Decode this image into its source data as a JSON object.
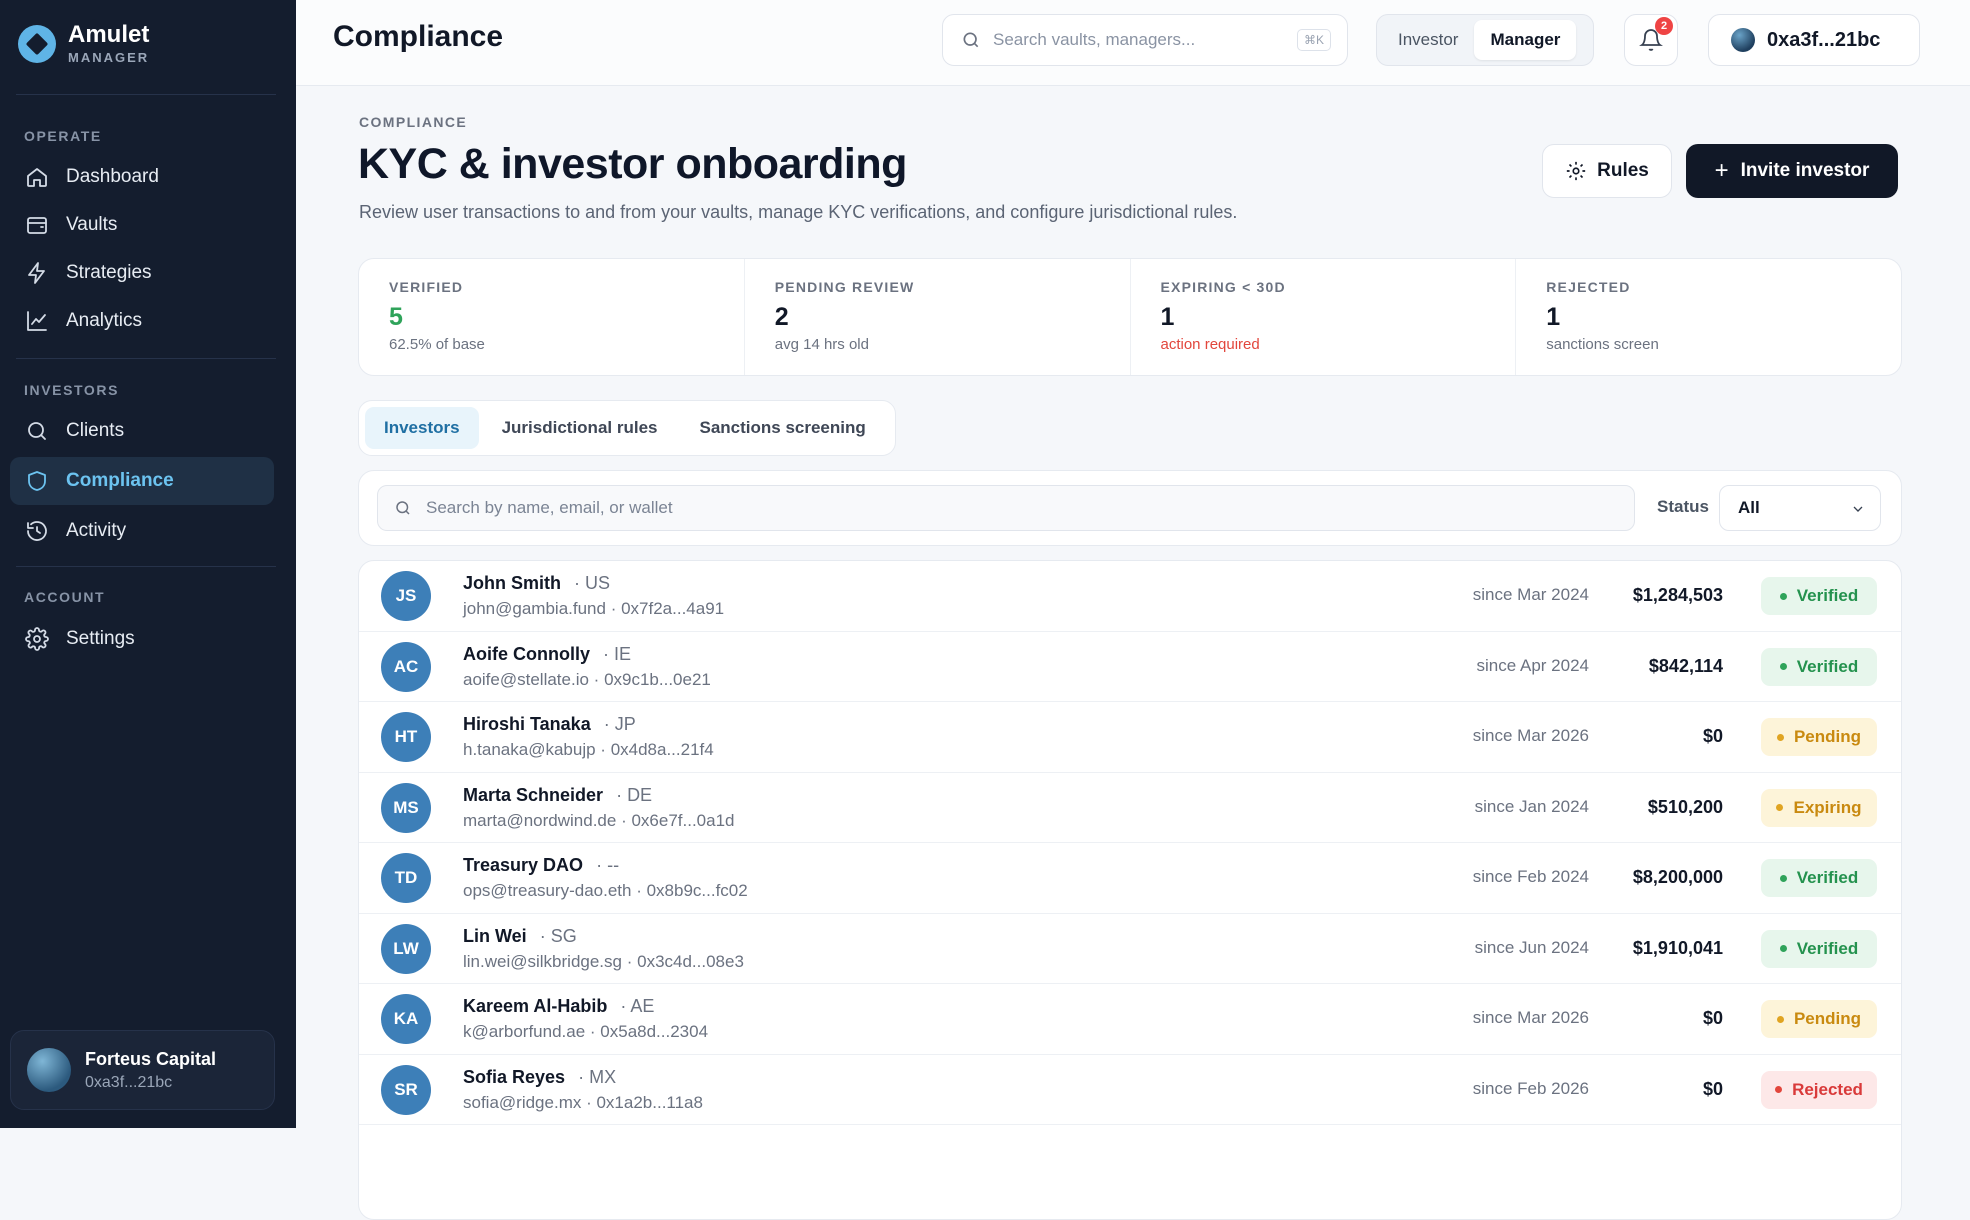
{
  "app": {
    "name": "Amulet",
    "subtitle": "MANAGER"
  },
  "sidebar": {
    "sections": [
      {
        "label": "OPERATE"
      },
      {
        "label": "INVESTORS"
      },
      {
        "label": "ACCOUNT"
      }
    ],
    "items": [
      {
        "label": "Dashboard",
        "icon": "home-icon"
      },
      {
        "label": "Vaults",
        "icon": "wallet-icon"
      },
      {
        "label": "Strategies",
        "icon": "lightning-icon"
      },
      {
        "label": "Analytics",
        "icon": "chart-icon"
      },
      {
        "label": "Clients",
        "icon": "search-icon"
      },
      {
        "label": "Compliance",
        "icon": "shield-icon",
        "active": true
      },
      {
        "label": "Activity",
        "icon": "history-icon"
      },
      {
        "label": "Settings",
        "icon": "gear-icon"
      }
    ],
    "org": {
      "name": "Forteus Capital",
      "wallet": "0xa3f...21bc"
    }
  },
  "topbar": {
    "title": "Compliance",
    "search_placeholder": "Search vaults, managers...",
    "shortcut": "⌘K",
    "roles": [
      "Investor",
      "Manager"
    ],
    "active_role": "Manager",
    "notification_count": "2",
    "wallet": "0xa3f...21bc"
  },
  "page": {
    "eyebrow": "COMPLIANCE",
    "title": "KYC & investor onboarding",
    "subtitle": "Review user transactions to and from your vaults, manage KYC verifications, and configure jurisdictional rules.",
    "rules_label": "Rules",
    "invite_label": "Invite investor",
    "invite_symbol": "+"
  },
  "stats": [
    {
      "label": "VERIFIED",
      "value": "5",
      "note": "62.5% of base"
    },
    {
      "label": "PENDING REVIEW",
      "value": "2",
      "note": "avg 14 hrs old"
    },
    {
      "label": "EXPIRING < 30D",
      "value": "1",
      "note": "action required"
    },
    {
      "label": "REJECTED",
      "value": "1",
      "note": "sanctions screen"
    }
  ],
  "tabs": [
    "Investors",
    "Jurisdictional rules",
    "Sanctions screening"
  ],
  "filters": {
    "search_placeholder": "Search by name, email, or wallet",
    "status_label": "Status",
    "status_value": "All"
  },
  "investors": [
    {
      "initials": "JS",
      "name": "John Smith",
      "country": "US",
      "email": "john@gambia.fund",
      "wallet": "0x7f2a...4a91",
      "since": "since Mar 2024",
      "amount": "$1,284,503",
      "status": "Verified"
    },
    {
      "initials": "AC",
      "name": "Aoife Connolly",
      "country": "IE",
      "email": "aoife@stellate.io",
      "wallet": "0x9c1b...0e21",
      "since": "since Apr 2024",
      "amount": "$842,114",
      "status": "Verified"
    },
    {
      "initials": "HT",
      "name": "Hiroshi Tanaka",
      "country": "JP",
      "email": "h.tanaka@kabujp",
      "wallet": "0x4d8a...21f4",
      "since": "since Mar 2026",
      "amount": "$0",
      "status": "Pending"
    },
    {
      "initials": "MS",
      "name": "Marta Schneider",
      "country": "DE",
      "email": "marta@nordwind.de",
      "wallet": "0x6e7f...0a1d",
      "since": "since Jan 2024",
      "amount": "$510,200",
      "status": "Expiring"
    },
    {
      "initials": "TD",
      "name": "Treasury DAO",
      "country": "--",
      "email": "ops@treasury-dao.eth",
      "wallet": "0x8b9c...fc02",
      "since": "since Feb 2024",
      "amount": "$8,200,000",
      "status": "Verified"
    },
    {
      "initials": "LW",
      "name": "Lin Wei",
      "country": "SG",
      "email": "lin.wei@silkbridge.sg",
      "wallet": "0x3c4d...08e3",
      "since": "since Jun 2024",
      "amount": "$1,910,041",
      "status": "Verified"
    },
    {
      "initials": "KA",
      "name": "Kareem Al-Habib",
      "country": "AE",
      "email": "k@arborfund.ae",
      "wallet": "0x5a8d...2304",
      "since": "since Mar 2026",
      "amount": "$0",
      "status": "Pending"
    },
    {
      "initials": "SR",
      "name": "Sofia Reyes",
      "country": "MX",
      "email": "sofia@ridge.mx",
      "wallet": "0x1a2b...11a8",
      "since": "since Feb 2026",
      "amount": "$0",
      "status": "Rejected"
    }
  ],
  "colors": {
    "sidebar_bg": "#141d2e",
    "accent": "#6cc3f0",
    "verified": "#2fa35a",
    "pending": "#e0a422",
    "rejected": "#e2463c"
  }
}
